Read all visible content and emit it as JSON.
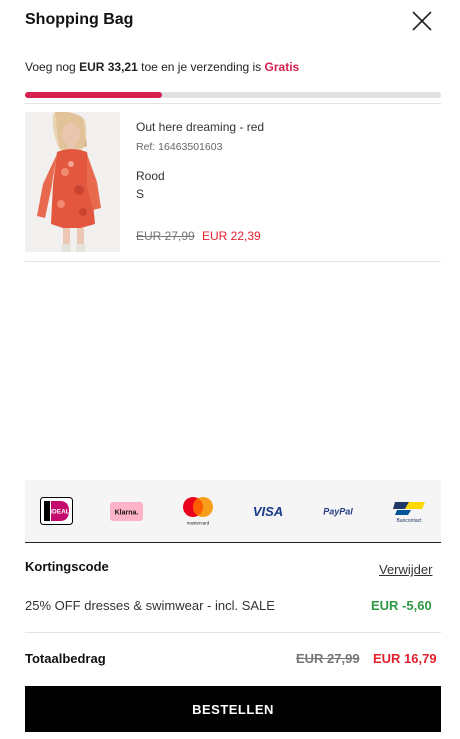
{
  "header": {
    "title": "Shopping Bag"
  },
  "shipping": {
    "prefix": "Voeg nog",
    "amount": "EUR 33,21",
    "middle": "toe en je verzending is",
    "free_label": "Gratis",
    "progress_fraction": 0.33
  },
  "item": {
    "name": "Out here dreaming - red",
    "ref": "Ref: 16463501603",
    "color": "Rood",
    "size": "S",
    "price_old": "EUR 27,99",
    "price_new": "EUR 22,39"
  },
  "payment_methods": [
    {
      "name": "iDEAL",
      "icon": "ideal-logo"
    },
    {
      "name": "Klarna.",
      "icon": "klarna-logo"
    },
    {
      "name": "mastercard",
      "icon": "mastercard-logo"
    },
    {
      "name": "VISA",
      "icon": "visa-logo"
    },
    {
      "name": "PayPal",
      "icon": "paypal-logo"
    },
    {
      "name": "Bancontact",
      "icon": "bancontact-logo"
    }
  ],
  "discount": {
    "label": "Kortingscode",
    "remove_label": "Verwijder",
    "description": "25% OFF dresses & swimwear - incl. SALE",
    "amount": "EUR -5,60"
  },
  "total": {
    "label": "Totaalbedrag",
    "old": "EUR 27,99",
    "new": "EUR 16,79"
  },
  "order_button": "BESTELLEN",
  "colors": {
    "accent": "#d6204e",
    "sale_price": "#e5202e",
    "discount": "#2e9a47",
    "button": "#000000"
  }
}
